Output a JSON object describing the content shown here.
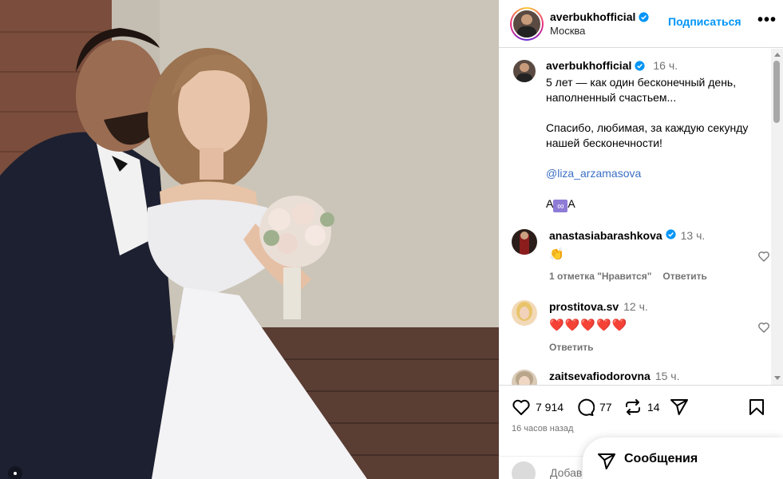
{
  "post": {
    "username": "averbukhofficial",
    "location": "Москва",
    "follow_label": "Подписаться",
    "more_label": "•••"
  },
  "caption": {
    "username": "averbukhofficial",
    "time": "16 ч.",
    "line1": "5 лет — как один бесконечный день,",
    "line2": "наполненный счастьем...",
    "line3": "Спасибо, любимая, за каждую секунду",
    "line4": "нашей бесконечности!",
    "mention": "@liza_arzamasova",
    "sign_left": "А",
    "sign_mid": "∞",
    "sign_right": "А"
  },
  "comments": [
    {
      "username": "anastasiabarashkova",
      "verified": true,
      "time": "13 ч.",
      "text": "👏",
      "likes_label": "1 отметка \"Нравится\"",
      "reply_label": "Ответить"
    },
    {
      "username": "prostitova.sv",
      "verified": false,
      "time": "12 ч.",
      "text": "❤️❤️❤️❤️❤️",
      "reply_label": "Ответить"
    },
    {
      "username": "zaitsevafiodorovna",
      "verified": false,
      "time": "15 ч."
    }
  ],
  "actions": {
    "likes": "7 914",
    "comments": "77",
    "reposts": "14",
    "posted_ago": "16 часов назад",
    "add_comment_placeholder": "Добав"
  },
  "messages": {
    "label": "Сообщения"
  },
  "colors": {
    "link": "#0095f6",
    "verified": "#0095f6",
    "muted": "#737373"
  }
}
